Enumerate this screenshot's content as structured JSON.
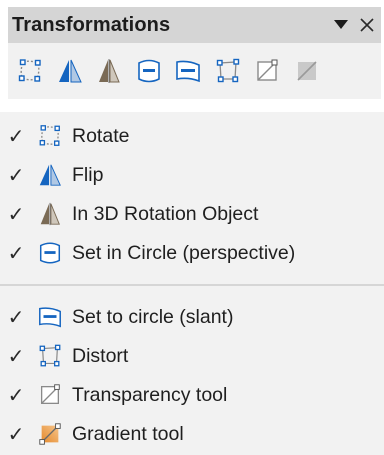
{
  "toolbar": {
    "title": "Transformations",
    "dropdown_glyph": "▼",
    "close_glyph": "✕",
    "buttons": [
      {
        "icon": "rotate-icon"
      },
      {
        "icon": "flip-icon"
      },
      {
        "icon": "3d-rotation-icon"
      },
      {
        "icon": "set-in-circle-perspective-icon"
      },
      {
        "icon": "set-to-circle-slant-icon"
      },
      {
        "icon": "distort-icon"
      },
      {
        "icon": "transparency-tool-icon"
      },
      {
        "icon": "gradient-tool-icon"
      }
    ]
  },
  "menu": {
    "check_glyph": "✓",
    "items": [
      {
        "label": "Rotate",
        "icon": "rotate-icon",
        "checked": true
      },
      {
        "label": "Flip",
        "icon": "flip-icon",
        "checked": true
      },
      {
        "label": "In 3D Rotation Object",
        "icon": "3d-rotation-icon",
        "checked": true
      },
      {
        "label": "Set in Circle (perspective)",
        "icon": "set-in-circle-perspective-icon",
        "checked": true
      },
      {
        "label": "Set to circle (slant)",
        "icon": "set-to-circle-slant-icon",
        "checked": true
      },
      {
        "label": "Distort",
        "icon": "distort-icon",
        "checked": true
      },
      {
        "label": "Transparency tool",
        "icon": "transparency-tool-icon",
        "checked": true
      },
      {
        "label": "Gradient tool",
        "icon": "gradient-tool-icon",
        "checked": true
      }
    ]
  },
  "colors": {
    "icon_blue": "#1565c0",
    "icon_gray": "#8a8a8a",
    "gradient_orange": "#e58a2e"
  }
}
